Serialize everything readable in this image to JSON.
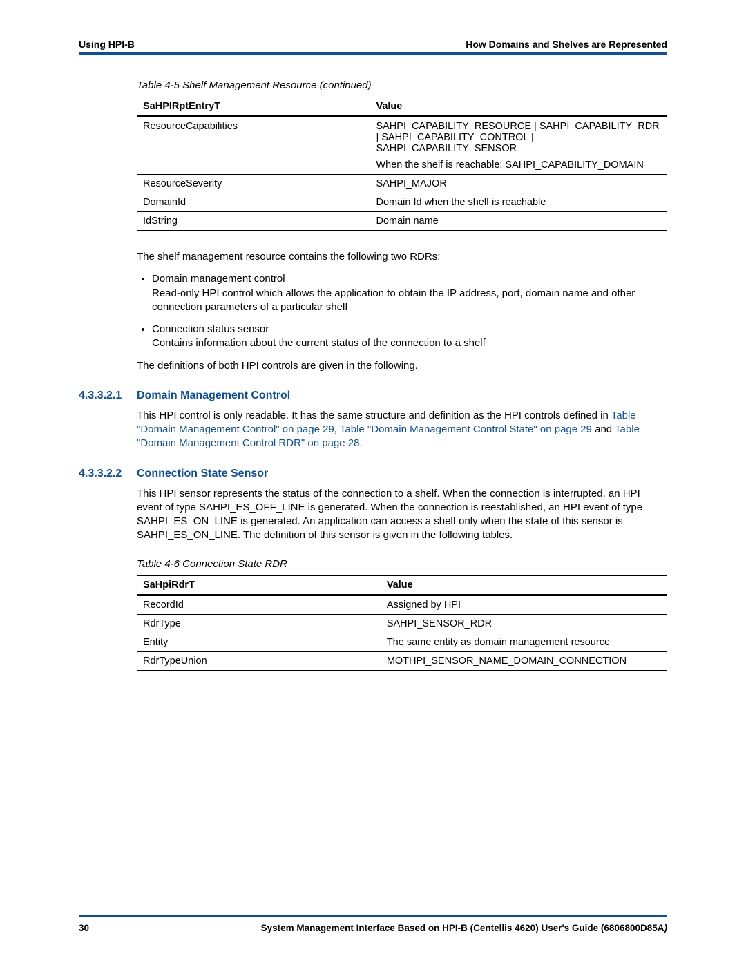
{
  "header": {
    "left": "Using HPI-B",
    "right": "How Domains and Shelves are Represented"
  },
  "table45": {
    "caption": "Table 4-5 Shelf Management Resource (continued)",
    "head": {
      "c1": "SaHPIRptEntryT",
      "c2": "Value"
    },
    "rows": [
      {
        "c1": "ResourceCapabilities",
        "c2": "SAHPI_CAPABILITY_RESOURCE | SAHPI_CAPABILITY_RDR | SAHPI_CAPABILITY_CONTROL | SAHPI_CAPABILITY_SENSOR",
        "c2b": "When the shelf is reachable: SAHPI_CAPABILITY_DOMAIN"
      },
      {
        "c1": "ResourceSeverity",
        "c2": "SAHPI_MAJOR"
      },
      {
        "c1": "DomainId",
        "c2": "Domain Id when the shelf is reachable"
      },
      {
        "c1": "IdString",
        "c2": "Domain name"
      }
    ]
  },
  "p1": "The shelf management resource contains the following two RDRs:",
  "bullets": [
    {
      "t": "Domain management control",
      "d": "Read-only HPI control which allows the application to obtain the IP address, port, domain name and other connection parameters of a particular shelf"
    },
    {
      "t": "Connection status sensor",
      "d": "Contains information about the current status of the connection to a shelf"
    }
  ],
  "p2": "The definitions of both HPI controls are given in the following.",
  "sec1": {
    "num": "4.3.3.2.1",
    "title": "Domain Management Control",
    "pre": "This HPI control is only readable. It has the same structure and definition as the HPI controls defined in ",
    "link1": "Table \"Domain Management Control\" on page 29",
    "sep1": ", ",
    "link2": "Table \"Domain Management Control State\" on page 29",
    "sep2": " and ",
    "link3": "Table \"Domain Management Control RDR\" on page 28",
    "post": "."
  },
  "sec2": {
    "num": "4.3.3.2.2",
    "title": "Connection State Sensor",
    "body": "This HPI sensor represents the status of the connection to a shelf. When the connection is interrupted, an HPI event of type SAHPI_ES_OFF_LINE is generated. When the connection is reestablished, an HPI event of type SAHPI_ES_ON_LINE is generated. An application can access a shelf only when the state of this sensor is SAHPI_ES_ON_LINE. The definition of this sensor is given in the following tables."
  },
  "table46": {
    "caption": "Table 4-6 Connection State RDR",
    "head": {
      "c1": "SaHpiRdrT",
      "c2": "Value"
    },
    "rows": [
      {
        "c1": "RecordId",
        "c2": "Assigned by HPI"
      },
      {
        "c1": "RdrType",
        "c2": "SAHPI_SENSOR_RDR"
      },
      {
        "c1": "Entity",
        "c2": "The same entity as domain management resource"
      },
      {
        "c1": "RdrTypeUnion",
        "c2": "MOTHPI_SENSOR_NAME_DOMAIN_CONNECTION"
      }
    ]
  },
  "footer": {
    "page": "30",
    "title": "System Management Interface Based on HPI-B (Centellis 4620) User's Guide (6806800D85A",
    "paren": ")"
  }
}
